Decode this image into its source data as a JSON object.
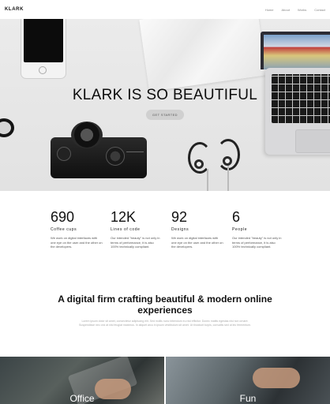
{
  "nav": {
    "logo": "KLARK",
    "items": [
      "Home",
      "About",
      "Works",
      "Contact"
    ]
  },
  "hero": {
    "title": "KLARK IS SO BEAUTIFUL",
    "cta": "GET STARTED"
  },
  "stats": [
    {
      "num": "690",
      "label": "Coffee cups",
      "desc": "We work on digital interfaces with one eye on the user and the other on the developers."
    },
    {
      "num": "12K",
      "label": "Lines of code",
      "desc": "Our intended \"beauty\" is not only in terms of performance, it is also 100% technically compliant."
    },
    {
      "num": "92",
      "label": "Designs",
      "desc": "We work on digital interfaces with one eye on the user and the other on the developers."
    },
    {
      "num": "6",
      "label": "People",
      "desc": "Our intended \"beauty\" is not only in terms of performance, it is also 100% technically compliant."
    }
  ],
  "intro": {
    "title": "A digital firm crafting beautiful & modern online experiences",
    "text": "Lorem ipsum dolor sit amet, consectetur adipiscing elit. Sed mollis nunc bibendum eu nisl efficitur. Donec mattis egestas nisi non ornare. Suspendisse nec orci at nisl feugiat maximus. In aliquet arcu in ipsum vestibulum sit amet. Ut tincidunt turpis, convallis sed ut leo fermentum."
  },
  "photos": [
    {
      "label": "Office"
    },
    {
      "label": "Fun"
    }
  ]
}
